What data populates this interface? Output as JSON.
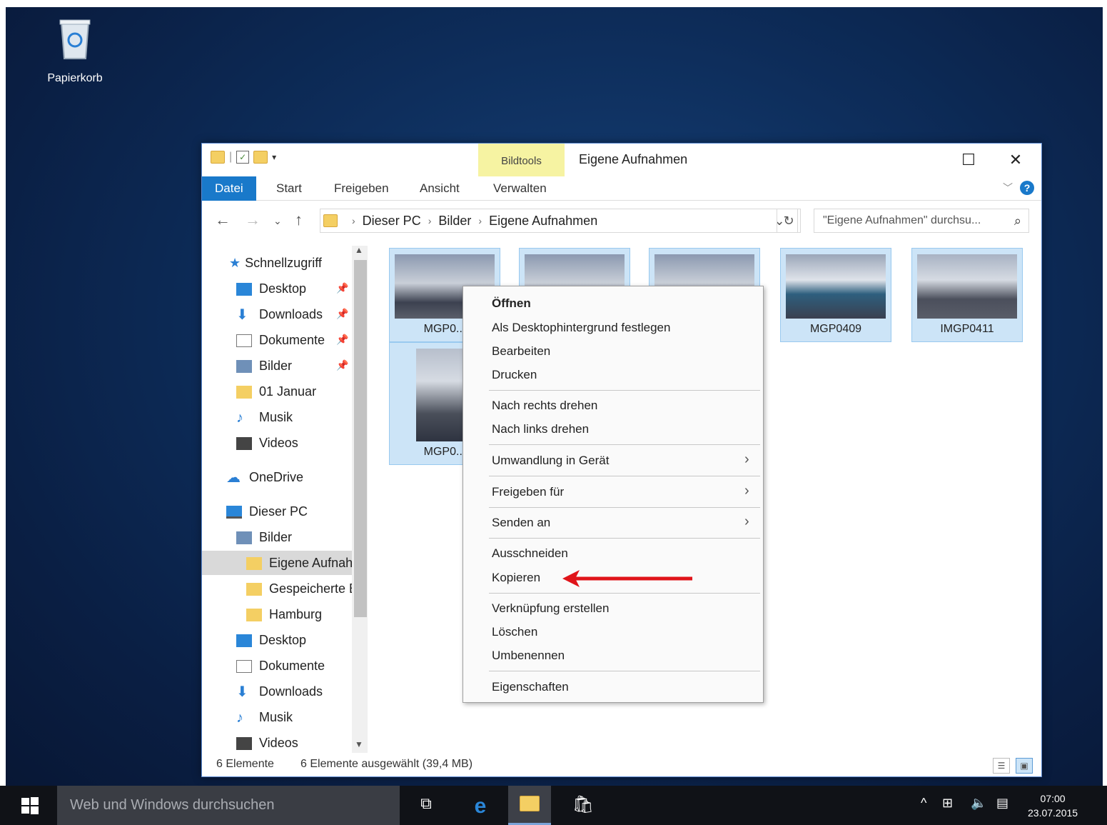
{
  "desktop": {
    "recycle_bin_label": "Papierkorb"
  },
  "window": {
    "title": "Eigene Aufnahmen",
    "context_tab": "Bildtools",
    "ribbon_tabs": [
      "Datei",
      "Start",
      "Freigeben",
      "Ansicht",
      "Verwalten"
    ],
    "address": {
      "crumbs": [
        "Dieser PC",
        "Bilder",
        "Eigene Aufnahmen"
      ]
    },
    "search_placeholder": "\"Eigene Aufnahmen\" durchsu..."
  },
  "nav": {
    "quick_access": "Schnellzugriff",
    "items": [
      {
        "label": "Desktop",
        "icon": "desktop-icon",
        "pinned": true
      },
      {
        "label": "Downloads",
        "icon": "download-icon",
        "pinned": true
      },
      {
        "label": "Dokumente",
        "icon": "document-icon",
        "pinned": true
      },
      {
        "label": "Bilder",
        "icon": "pictures-icon",
        "pinned": true
      },
      {
        "label": "01 Januar",
        "icon": "folder-icon"
      },
      {
        "label": "Musik",
        "icon": "music-icon"
      },
      {
        "label": "Videos",
        "icon": "video-icon"
      },
      {
        "label": "OneDrive",
        "icon": "onedrive-icon"
      },
      {
        "label": "Dieser PC",
        "icon": "pc-icon"
      },
      {
        "label": "Bilder",
        "icon": "pictures-icon"
      },
      {
        "label": "Eigene Aufnahmen",
        "icon": "folder-icon",
        "selected": true
      },
      {
        "label": "Gespeicherte Bilder",
        "icon": "folder-icon"
      },
      {
        "label": "Hamburg",
        "icon": "folder-icon"
      },
      {
        "label": "Desktop",
        "icon": "desktop-icon"
      },
      {
        "label": "Dokumente",
        "icon": "document-icon"
      },
      {
        "label": "Downloads",
        "icon": "download-icon"
      },
      {
        "label": "Musik",
        "icon": "music-icon"
      },
      {
        "label": "Videos",
        "icon": "video-icon"
      }
    ]
  },
  "files": [
    {
      "name": "MGP0..."
    },
    {
      "name": ""
    },
    {
      "name": ""
    },
    {
      "name": "MGP0409"
    },
    {
      "name": "IMGP0411"
    },
    {
      "name": "MGP0..."
    }
  ],
  "context_menu": {
    "items": [
      "Öffnen",
      "Als Desktophintergrund festlegen",
      "Bearbeiten",
      "Drucken",
      "Nach rechts drehen",
      "Nach links drehen",
      "Umwandlung in Gerät",
      "Freigeben für",
      "Senden an",
      "Ausschneiden",
      "Kopieren",
      "Verknüpfung erstellen",
      "Löschen",
      "Umbenennen",
      "Eigenschaften"
    ]
  },
  "status": {
    "count": "6 Elemente",
    "selection": "6 Elemente ausgewählt (39,4 MB)"
  },
  "taskbar": {
    "search_placeholder": "Web und Windows durchsuchen",
    "time": "07:00",
    "date": "23.07.2015"
  },
  "colors": {
    "accent": "#1979ca",
    "selection": "#cce4f7",
    "context_tab": "#f6f3a2",
    "arrow": "#e0141a"
  }
}
